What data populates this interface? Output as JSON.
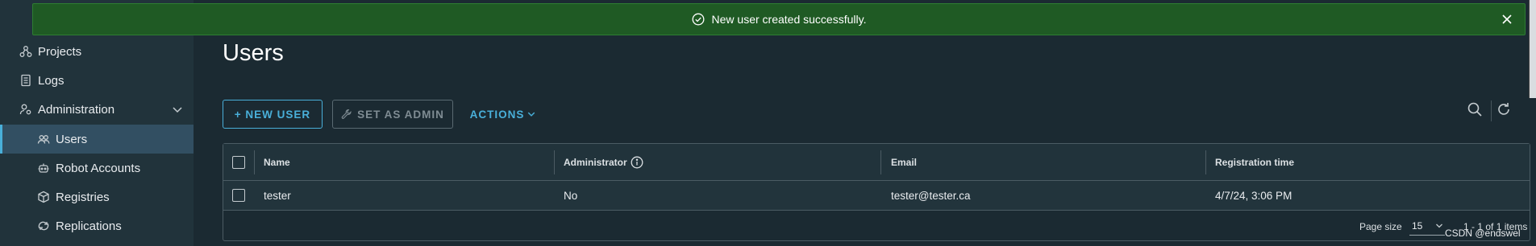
{
  "banner": {
    "message": "New user created successfully.",
    "icon": "check-circle-icon",
    "close_icon": "close-icon"
  },
  "sidebar": {
    "items": [
      {
        "label": "Projects",
        "icon": "projects-icon"
      },
      {
        "label": "Logs",
        "icon": "logs-icon"
      },
      {
        "label": "Administration",
        "icon": "admin-icon",
        "expanded": true
      },
      {
        "label": "Users",
        "icon": "users-icon",
        "active": true
      },
      {
        "label": "Robot Accounts",
        "icon": "robot-icon"
      },
      {
        "label": "Registries",
        "icon": "registries-icon"
      },
      {
        "label": "Replications",
        "icon": "replications-icon"
      }
    ]
  },
  "page": {
    "title": "Users"
  },
  "toolbar": {
    "new_user": "+ NEW USER",
    "set_admin": "SET AS ADMIN",
    "actions": "ACTIONS"
  },
  "table": {
    "columns": [
      "Name",
      "Administrator",
      "Email",
      "Registration time"
    ],
    "rows": [
      {
        "name": "tester",
        "administrator": "No",
        "email": "tester@tester.ca",
        "registration_time": "4/7/24, 3:06 PM"
      }
    ]
  },
  "footer": {
    "page_size_label": "Page size",
    "page_size_value": "15",
    "range_text": "1 - 1 of 1 items"
  },
  "watermark": "CSDN @endswel",
  "colors": {
    "background": "#1b2a32",
    "sidebar": "#21333b",
    "accent": "#49afd9",
    "success": "#1f5a24"
  }
}
